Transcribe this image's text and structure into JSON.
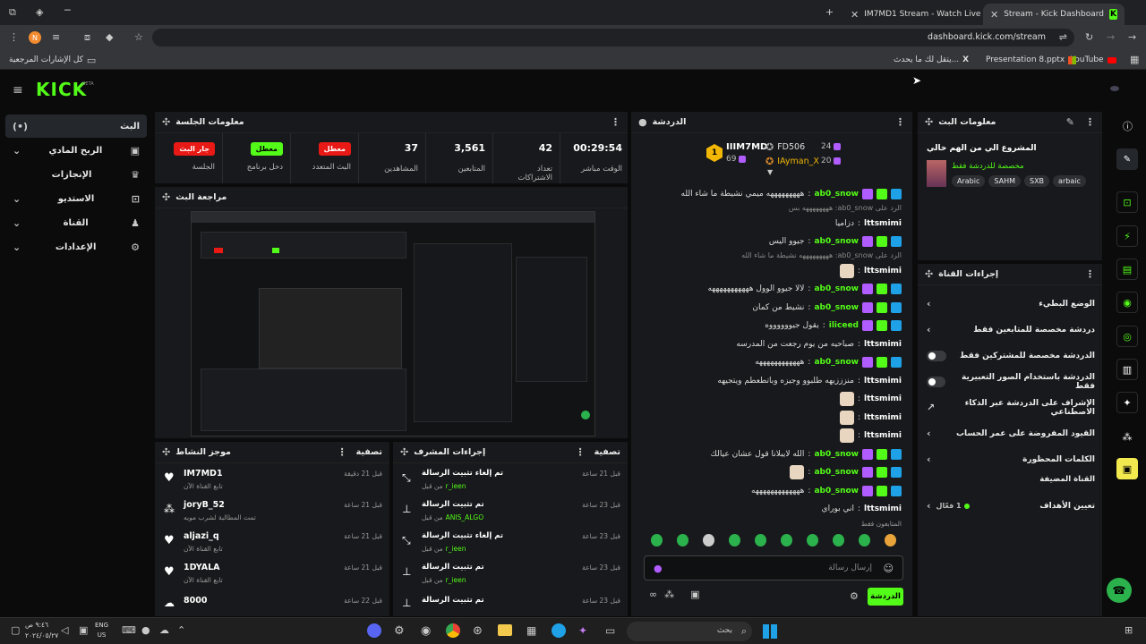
{
  "browser": {
    "tabs": [
      {
        "label": "IM7MD1 Stream - Watch Live o"
      },
      {
        "label": "Stream - Kick Dashboard"
      }
    ],
    "address": "dashboard.kick.com/stream",
    "profile_initial": "N",
    "bookmarks": [
      "كل الإشارات المرجعية",
      "YouTube",
      "Presentation 8.pptx",
      "يتقل لك ما يحدث...",
      "X"
    ]
  },
  "app": {
    "logo": "KICK",
    "logo_sup": "BETA"
  },
  "sidebar": {
    "items": [
      {
        "label": "البث"
      },
      {
        "label": "الربح المادي"
      },
      {
        "label": "الإنجازات"
      },
      {
        "label": "الاستديو"
      },
      {
        "label": "القناة"
      },
      {
        "label": "الإعدادات"
      }
    ]
  },
  "session": {
    "title": "معلومات الجلسة",
    "stats": [
      {
        "value": "00:29:54",
        "label": "الوقت مباشر"
      },
      {
        "value": "42",
        "label": "تعداد الاشتراكات"
      },
      {
        "value": "3,561",
        "label": "المتابعين"
      },
      {
        "value": "37",
        "label": "المشاهدين"
      },
      {
        "badge": "معطل",
        "label": "البث المتعدد"
      },
      {
        "badge": "معطل",
        "label": "دخل برنامج"
      },
      {
        "badge": "جار البث",
        "label": "الجلسة"
      }
    ]
  },
  "preview": {
    "title": "مراجعة البث"
  },
  "activity": {
    "title": "موجز النشاط",
    "filter": "تصفية",
    "items": [
      {
        "user": "IM7MD1",
        "desc": "تابع القناة الآن",
        "time": "قبل 21 دقيقة"
      },
      {
        "user": "joryB_52",
        "desc": "تمت المطالبة لشرب مويه",
        "time": "قبل 21 ساعة"
      },
      {
        "user": "aljazi_q",
        "desc": "تابع القناة الآن",
        "time": "قبل 21 ساعة"
      },
      {
        "user": "1DYALA",
        "desc": "تابع القناة الآن",
        "time": "قبل 21 ساعة"
      },
      {
        "user": "8000",
        "desc": "",
        "time": "قبل 22 ساعة"
      }
    ]
  },
  "modactions": {
    "title": "إجراءات المشرف",
    "filter": "تصفية",
    "items": [
      {
        "action": "تم إلغاء تثبيت الرسالة",
        "by": "من قبل",
        "user": "r_ieen",
        "time": "قبل 21 ساعة"
      },
      {
        "action": "تم تثبيت الرسالة",
        "by": "من قبل",
        "user": "ANIS_ALGO",
        "time": "قبل 23 ساعة"
      },
      {
        "action": "تم إلغاء تثبيت الرسالة",
        "by": "من قبل",
        "user": "r_ieen",
        "time": "قبل 23 ساعة"
      },
      {
        "action": "تم تثبيت الرسالة",
        "by": "من قبل",
        "user": "r_ieen",
        "time": "قبل 23 ساعة"
      },
      {
        "action": "تم تثبيت الرسالة",
        "by": "",
        "user": "",
        "time": "قبل 23 ساعة"
      }
    ]
  },
  "chat": {
    "title": "الدردشة",
    "leaders": [
      {
        "rank": "1",
        "name": "IIIM7MD",
        "score": "69"
      },
      {
        "name": "FD506",
        "score": "24"
      },
      {
        "name": "IAyman_X",
        "score": "20"
      }
    ],
    "messages": [
      {
        "user": "ab0_snow",
        "text": "هههههههههه ميمي نشيطة ما شاء الله",
        "type": "badged"
      },
      {
        "reply": "الرد على ab0_snow: ههههههههه بس"
      },
      {
        "user": "lttsmimi",
        "text": "دزاميا",
        "type": "plain"
      },
      {
        "user": "ab0_snow",
        "text": "جيوو اليس",
        "type": "badged"
      },
      {
        "reply": "الرد على ab0_snow: هههههههههه نشيطة ما شاء الله"
      },
      {
        "user": "lttsmimi",
        "text": "",
        "type": "plain"
      },
      {
        "user": "ab0_snow",
        "text": "لالا جيوو الوول هههههههههههه",
        "type": "badged"
      },
      {
        "user": "ab0_snow",
        "text": "نشيط من كمان",
        "type": "badged"
      },
      {
        "user": "iliceed",
        "text": "يقول جيووووووه",
        "type": "badged"
      },
      {
        "user": "lttsmimi",
        "text": "صباحيه من يوم رجعت من المدرسه",
        "type": "plain"
      },
      {
        "user": "ab0_snow",
        "text": "ههههههههههههه",
        "type": "badged"
      },
      {
        "user": "lttsmimi",
        "text": "منزززيهه طلبوو وجيزه وباتطعطم ويتجيهه",
        "type": "plain"
      },
      {
        "user": "lttsmimi",
        "text": "",
        "type": "plain"
      },
      {
        "user": "lttsmimi",
        "text": "",
        "type": "plain"
      },
      {
        "user": "lttsmimi",
        "text": "",
        "type": "plain"
      },
      {
        "user": "ab0_snow",
        "text": "الله لايبلانا قول عشان عيالك",
        "type": "badged"
      },
      {
        "user": "ab0_snow",
        "text": "",
        "type": "badged"
      },
      {
        "user": "ab0_snow",
        "text": "هههههههههههههه",
        "type": "badged"
      },
      {
        "user": "lttsmimi",
        "text": "اني بوراي",
        "type": "plain"
      }
    ],
    "followers_only": "المتابعون فقط",
    "input_placeholder": "إرسال رسالة",
    "send": "الدردشة"
  },
  "streaminfo": {
    "title": "معلومات البث",
    "stream_title": "المشروع الي من الهم خالي",
    "category": "مخصصة للدردشة فقط",
    "tags": [
      "Arabic",
      "SAHM",
      "SXB",
      "arbaic"
    ]
  },
  "channel_actions": {
    "title": "إجراءات القناة",
    "items": [
      {
        "label": "الوضع البطيء",
        "control": "chevron"
      },
      {
        "label": "دردشة مخصصة للمتابعين فقط",
        "control": "chevron"
      },
      {
        "label": "الدردشة مخصصة للمشتركين فقط",
        "control": "toggle"
      },
      {
        "label": "الدردشة باستخدام الصور التعبيرية فقط",
        "control": "toggle"
      },
      {
        "label": "الإشراف على الدردشة عبر الذكاء الاصطناعي",
        "control": "link"
      },
      {
        "label": "القيود المفروضة على عمر الحساب",
        "control": "chevron"
      },
      {
        "label": "الكلمات المحظورة",
        "control": "chevron"
      }
    ],
    "section": "القناة المضيفة",
    "goals": {
      "label": "تعيين الأهداف",
      "value": "1 فعّال"
    }
  },
  "taskbar": {
    "search": "بحث",
    "lang": "ENG",
    "region": "US",
    "time": "٩:٤٦ ص",
    "date": "٢٠٢٤/٠٥/٢٧"
  },
  "colors": {
    "accent": "#53fc18",
    "panel": "#18191c",
    "live": "#e91916"
  }
}
